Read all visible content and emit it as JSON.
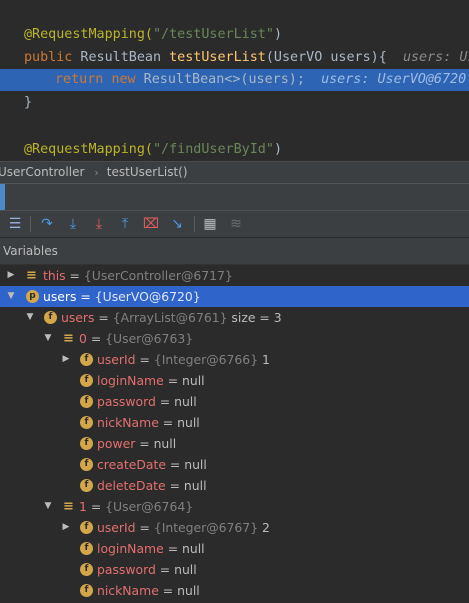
{
  "code": {
    "line1": {
      "annotation": "@RequestMapping(",
      "path": "\"/testUserList\"",
      "close": ")"
    },
    "line2": {
      "kw": "public",
      "rest1": " ResultBean ",
      "method": "testUserList",
      "rest2": "(UserVO users){",
      "hint": "users: Us"
    },
    "line3": {
      "kw1": "return",
      "kw2": "new",
      "rest": " ResultBean<>(users);",
      "hint": "users: UserVO@6720"
    },
    "line4": {
      "text": "}"
    },
    "line6": {
      "annotation": "@RequestMapping(",
      "path": "\"/findUserById\"",
      "close": ")"
    }
  },
  "breadcrumb": {
    "first": "UserController",
    "second": "testUserList()"
  },
  "toolbar": {
    "icons": [
      "frames-icon",
      "step-over-icon",
      "step-into-icon",
      "force-step-into-icon",
      "step-out-icon",
      "drop-frame-icon",
      "run-to-cursor-icon",
      "evaluate-icon",
      "trace-icon"
    ]
  },
  "variables": {
    "header": "Variables",
    "rows": [
      {
        "name": "this",
        "eq": " = ",
        "type": "{UserController@6717}",
        "value": "",
        "icon": "list-icon"
      },
      {
        "name": "users",
        "eq": " = ",
        "type": "{UserVO@6720}",
        "value": "",
        "icon": "p-icon"
      },
      {
        "name": "users",
        "eq": " = ",
        "type": "{ArrayList@6761}",
        "value": "  size = 3",
        "icon": "f-icon"
      },
      {
        "name": "0",
        "eq": " = ",
        "type": "{User@6763}",
        "value": "",
        "icon": "list-icon"
      },
      {
        "name": "userId",
        "eq": " = ",
        "type": "{Integer@6766}",
        "value": " 1",
        "icon": "f-icon"
      },
      {
        "name": "loginName",
        "eq": " = ",
        "type": "",
        "value": "null",
        "icon": "f-icon"
      },
      {
        "name": "password",
        "eq": " = ",
        "type": "",
        "value": "null",
        "icon": "f-icon"
      },
      {
        "name": "nickName",
        "eq": " = ",
        "type": "",
        "value": "null",
        "icon": "f-icon"
      },
      {
        "name": "power",
        "eq": " = ",
        "type": "",
        "value": "null",
        "icon": "f-icon"
      },
      {
        "name": "createDate",
        "eq": " = ",
        "type": "",
        "value": "null",
        "icon": "f-icon"
      },
      {
        "name": "deleteDate",
        "eq": " = ",
        "type": "",
        "value": "null",
        "icon": "f-icon"
      },
      {
        "name": "1",
        "eq": " = ",
        "type": "{User@6764}",
        "value": "",
        "icon": "list-icon"
      },
      {
        "name": "userId",
        "eq": " = ",
        "type": "{Integer@6767}",
        "value": " 2",
        "icon": "f-icon"
      },
      {
        "name": "loginName",
        "eq": " = ",
        "type": "",
        "value": "null",
        "icon": "f-icon"
      },
      {
        "name": "password",
        "eq": " = ",
        "type": "",
        "value": "null",
        "icon": "f-icon"
      },
      {
        "name": "nickName",
        "eq": " = ",
        "type": "",
        "value": "null",
        "icon": "f-icon"
      }
    ]
  },
  "colors": {
    "selection": "#2f65ca",
    "accent": "#4a88c7",
    "field_name": "#e46f6f",
    "icon": "#d4a64a"
  }
}
